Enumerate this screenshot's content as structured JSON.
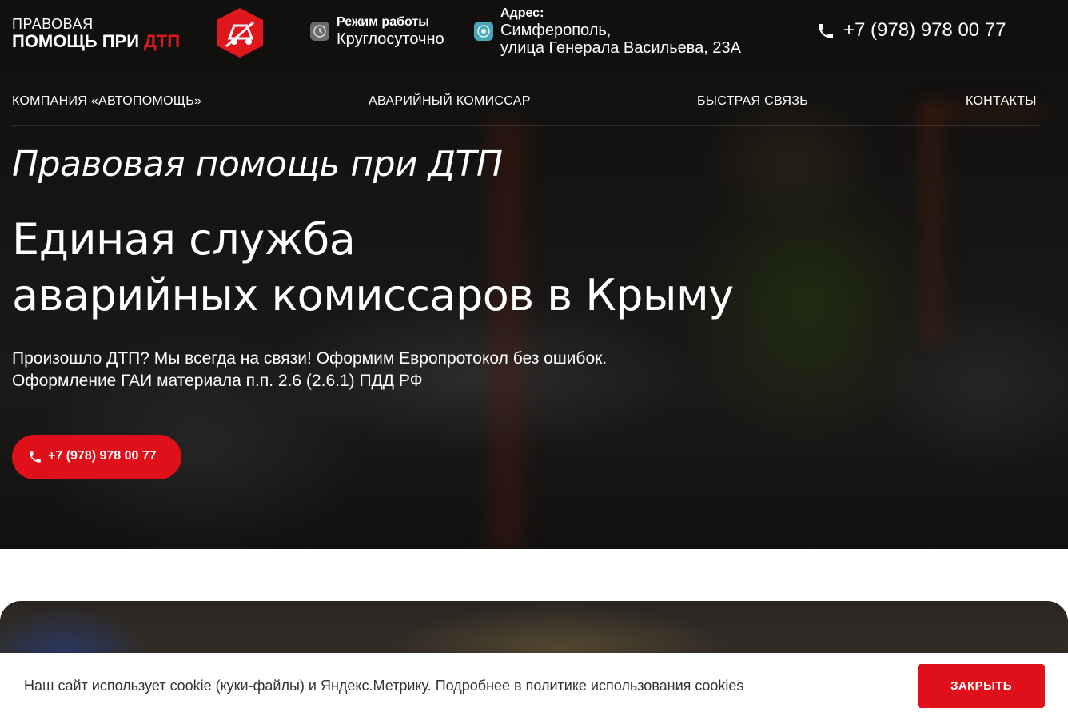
{
  "header": {
    "logo": {
      "line1": "ПРАВОВАЯ",
      "line2_white": "ПОМОЩЬ ПРИ ",
      "line2_red": "ДТП"
    },
    "hours": {
      "label": "Режим работы",
      "value": "Круглосуточно",
      "icon": "clock-icon"
    },
    "address": {
      "label": "Адрес:",
      "line1": "Симферополь,",
      "line2": "улица Генерала Васильева, 23А",
      "icon": "location-icon"
    },
    "phone": {
      "text": "+7 (978) 978 00 77",
      "icon": "phone-icon"
    }
  },
  "nav": {
    "items": [
      {
        "label": "КОМПАНИЯ «АВТОПОМОЩЬ»"
      },
      {
        "label": "АВАРИЙНЫЙ КОМИССАР"
      },
      {
        "label": "БЫСТРАЯ СВЯЗЬ"
      },
      {
        "label": "КОНТАКТЫ"
      }
    ]
  },
  "hero": {
    "subtitle": "Правовая помощь при ДТП",
    "title_line1": "Единая служба",
    "title_line2": "аварийных комиссаров в Крыму",
    "lead_line1": "Произошло ДТП? Мы всегда на связи! Оформим Европротокол без ошибок.",
    "lead_line2": "Оформление ГАИ материала п.п. 2.6 (2.6.1) ПДД РФ",
    "cta_label": "+7 (978) 978 00 77"
  },
  "cookie": {
    "text": "Наш сайт использует cookie (куки-файлы) и Яндекс.Метрику. Подробнее в ",
    "link": "политике использования cookies",
    "button": "ЗАКРЫТЬ"
  },
  "colors": {
    "accent": "#e0101a",
    "hero_bg": "#1c1a18",
    "text_light": "#ffffff"
  }
}
